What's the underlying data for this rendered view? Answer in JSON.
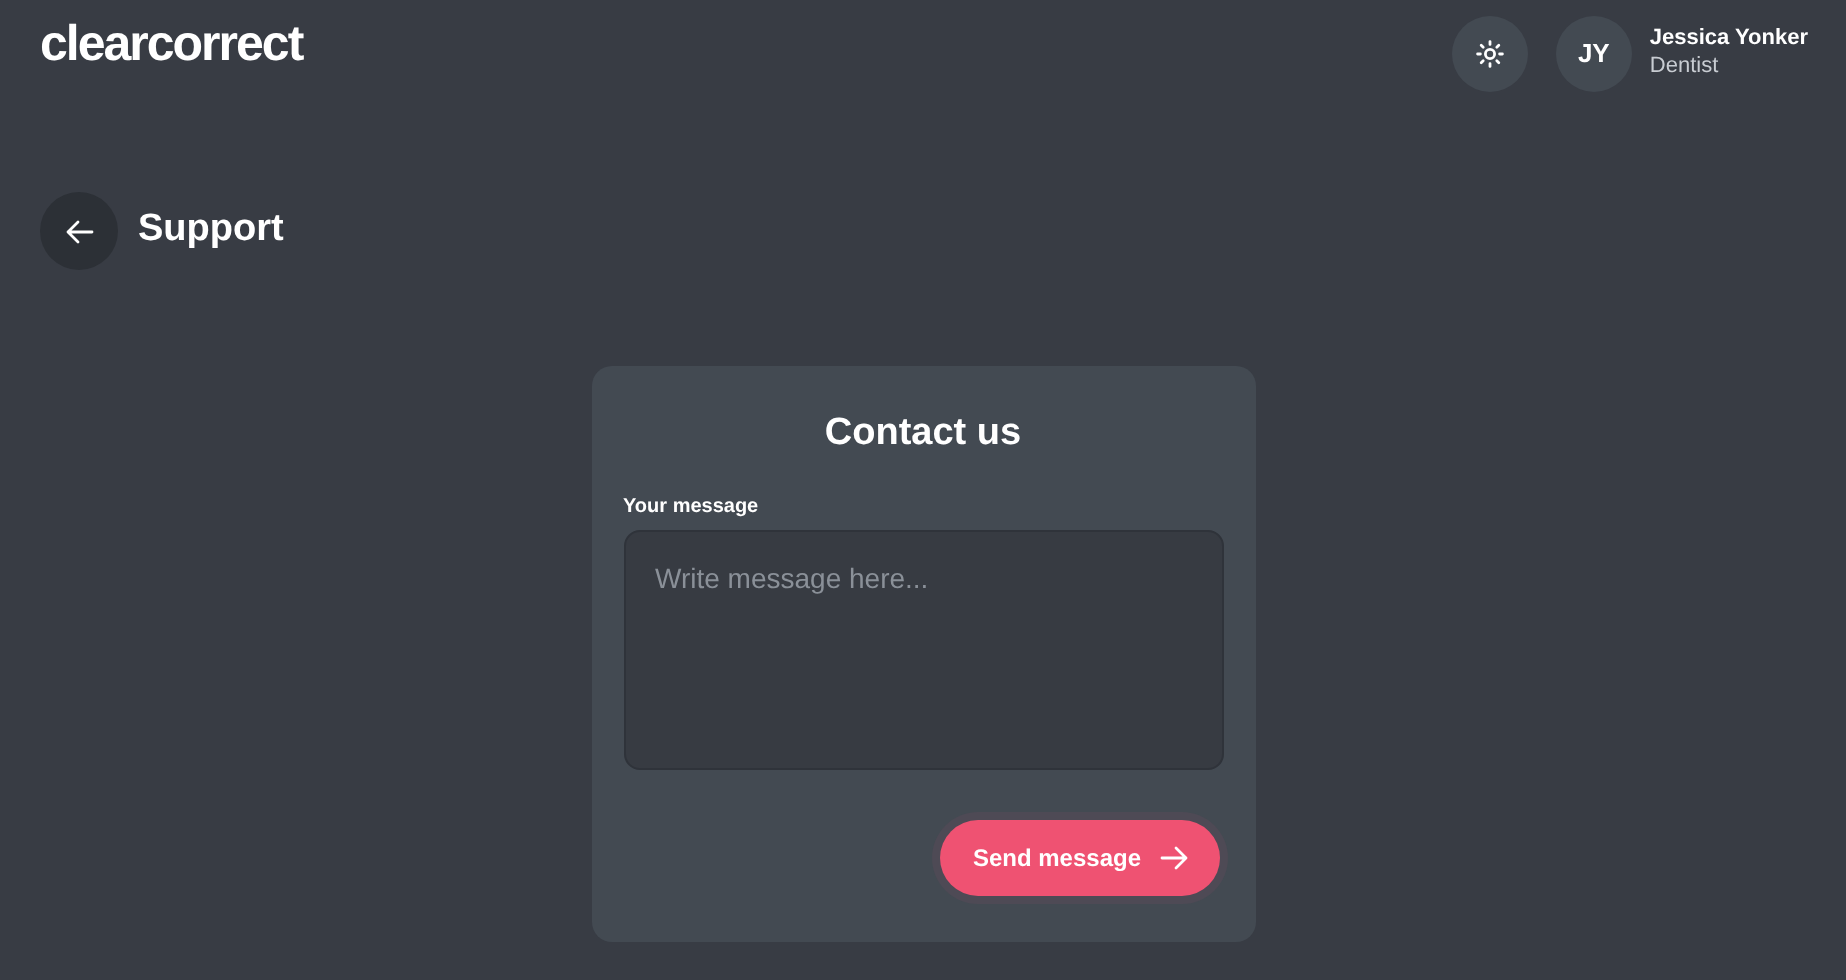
{
  "header": {
    "logo": "clearcorrect",
    "user": {
      "initials": "JY",
      "name": "Jessica Yonker",
      "role": "Dentist"
    }
  },
  "page": {
    "title": "Support"
  },
  "contact_form": {
    "title": "Contact us",
    "message_label": "Your message",
    "message": {
      "placeholder": "Write message here..."
    },
    "submit_button": "Send message"
  }
}
